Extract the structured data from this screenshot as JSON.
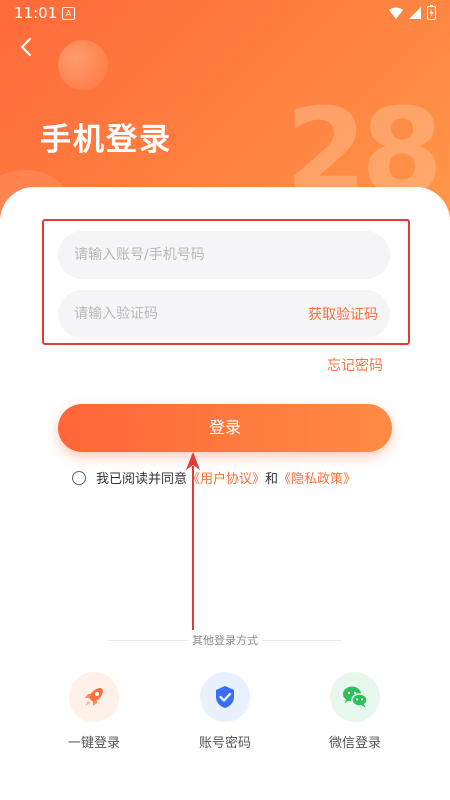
{
  "status_bar": {
    "time": "11:01",
    "notification": "A"
  },
  "header": {
    "title": "手机登录",
    "decor_number": "28"
  },
  "form": {
    "account_placeholder": "请输入账号/手机号码",
    "code_placeholder": "请输入验证码",
    "get_code_label": "获取验证码",
    "forgot_label": "忘记密码",
    "login_label": "登录"
  },
  "agreement": {
    "prefix": "我已阅读并同意",
    "user_agreement": "《用户协议》",
    "and": "和",
    "privacy_policy": "《隐私政策》"
  },
  "other_login": {
    "title": "其他登录方式",
    "options": [
      {
        "label": "一键登录",
        "icon": "rocket-icon",
        "color": "#ff6f3c",
        "bg": "#fff1e9"
      },
      {
        "label": "账号密码",
        "icon": "shield-check-icon",
        "color": "#3b6ef6",
        "bg": "#e9f0ff"
      },
      {
        "label": "微信登录",
        "icon": "wechat-icon",
        "color": "#2ec05a",
        "bg": "#e7f7ee"
      }
    ]
  },
  "colors": {
    "accent": "#ff6f3c",
    "highlight": "#e53935"
  }
}
